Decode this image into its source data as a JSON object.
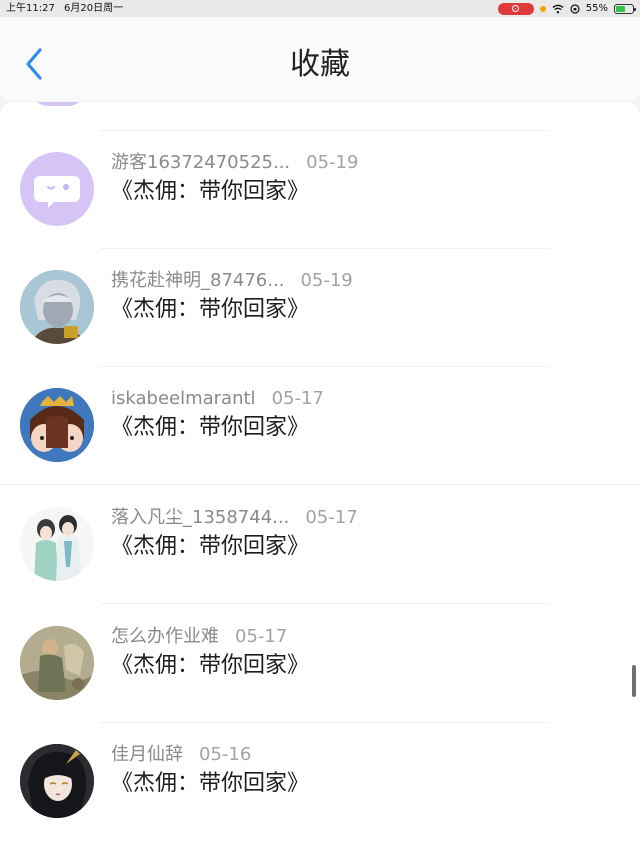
{
  "status": {
    "time": "上午11:27",
    "date": "6月20日周一",
    "battery": "55%",
    "battery_level": 0.55
  },
  "header": {
    "title": "收藏"
  },
  "items": [
    {
      "name": "游客16372470525...",
      "date": "05-19",
      "book": "《杰佣：带你回家》",
      "avatar_icon": "chat-bubble-face-icon"
    },
    {
      "name": "携花赴神明_87476...",
      "date": "05-19",
      "book": "《杰佣：带你回家》",
      "avatar_icon": "silver-hair-character-icon"
    },
    {
      "name": "iskabeelmarantl",
      "date": "05-17",
      "book": "《杰佣：带你回家》",
      "avatar_icon": "twin-character-icon"
    },
    {
      "name": "落入凡尘_1358744...",
      "date": "05-17",
      "book": "《杰佣：带你回家》",
      "avatar_icon": "couple-illustration-icon"
    },
    {
      "name": "怎么办作业难",
      "date": "05-17",
      "book": "《杰佣：带你回家》",
      "avatar_icon": "painting-icon"
    },
    {
      "name": "佳月仙辞",
      "date": "05-16",
      "book": "《杰佣：带你回家》",
      "avatar_icon": "dark-hair-character-icon"
    }
  ],
  "colors": {
    "accent": "#2f8de4",
    "avatar_purple": "#d7c4f7"
  }
}
